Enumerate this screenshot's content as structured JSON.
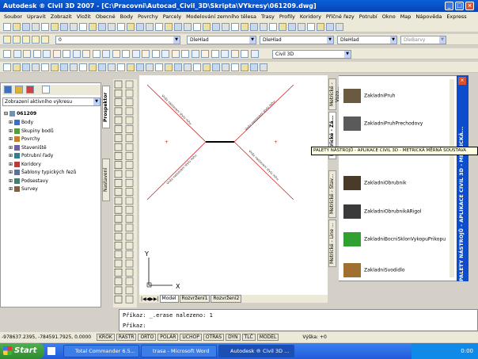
{
  "window": {
    "title": "Autodesk ® Civil 3D 2007 - [C:\\Pracovni\\Autocad_Civil_3D\\Skripta\\VYkresy\\061209.dwg]"
  },
  "menu": [
    "Soubor",
    "Upravit",
    "Zobrazit",
    "Vložit",
    "Obecné",
    "Body",
    "Povrchy",
    "Parcely",
    "Modelování zemního tělesa",
    "Trasy",
    "Profily",
    "Koridory",
    "Příčné řezy",
    "Potrubí",
    "Okno",
    "Map",
    "Nápověda",
    "Express"
  ],
  "toolbar2": {
    "layer_value": "0",
    "color_value": "DleHlad",
    "linetype_value": "DleHlad",
    "lineweight_value": "DleHlad",
    "plotstyle_value": "DleBarvy"
  },
  "toolbar3": {
    "workspace_value": "Civil 3D"
  },
  "prospector": {
    "view_select": "Zobrazení aktivního výkresu",
    "tab_label": "Prospektor",
    "settings_tab": "Nastavení",
    "root": "061209",
    "items": [
      "Body",
      "Skupiny bodů",
      "Povrchy",
      "Staveniště",
      "Potrubní řady",
      "Koridory",
      "Šablony typických řezů",
      "Podsestavy",
      "Survey"
    ]
  },
  "drawing": {
    "labels": [
      "Vněz nastavení stylu rohu",
      "Vněz nastavení stylu rohu",
      "Vněz nastavení stylu rohu",
      "Vněz nastavení stylu rohu"
    ],
    "axis_x": "X",
    "axis_y": "Y"
  },
  "layout_tabs": [
    "Model",
    "Rozvržení1",
    "Rozvržení2"
  ],
  "palette": {
    "title": "PALETY NÁSTROJŮ - APLIKACE CIVIL 3D - METRICKÁ...",
    "side_tabs": [
      "Metrické - Vozo...",
      "Metrické - Zá...",
      "Metrické - Stav...",
      "Metrické - Line ..."
    ],
    "tools": [
      "ZakladniPruh",
      "ZakladniPruhPrechodovy",
      "ZakladniObrubnik",
      "ZakladniObrubnikARigol",
      "ZakladniBocniSklonVykopuPrikopu",
      "ZakladniSvodidlo"
    ]
  },
  "tooltip": "PALETY NÁSTROJŮ - APLIKACE CIVIL 3D - METRICKÁ MĚRNÁ SOUSTAVA",
  "command": {
    "line1": "Příkaz: _.erase nalezeno: 1",
    "line2": "Příkaz:"
  },
  "status": {
    "coords": "-978637.2395, -784591.7925, 0.0000",
    "buttons": [
      "KROK",
      "RASTR",
      "ORTO",
      "POLÁR",
      "UCHOP",
      "OTRAS",
      "DYN",
      "TLČ",
      "MODEL"
    ],
    "scale": "Výška: +0"
  },
  "taskbar": {
    "start": "Start",
    "tasks": [
      "Total Commander 6.5...",
      "trasa - Microsoft Word",
      "Autodesk ® Civil 3D ..."
    ],
    "clock": "0:00"
  }
}
